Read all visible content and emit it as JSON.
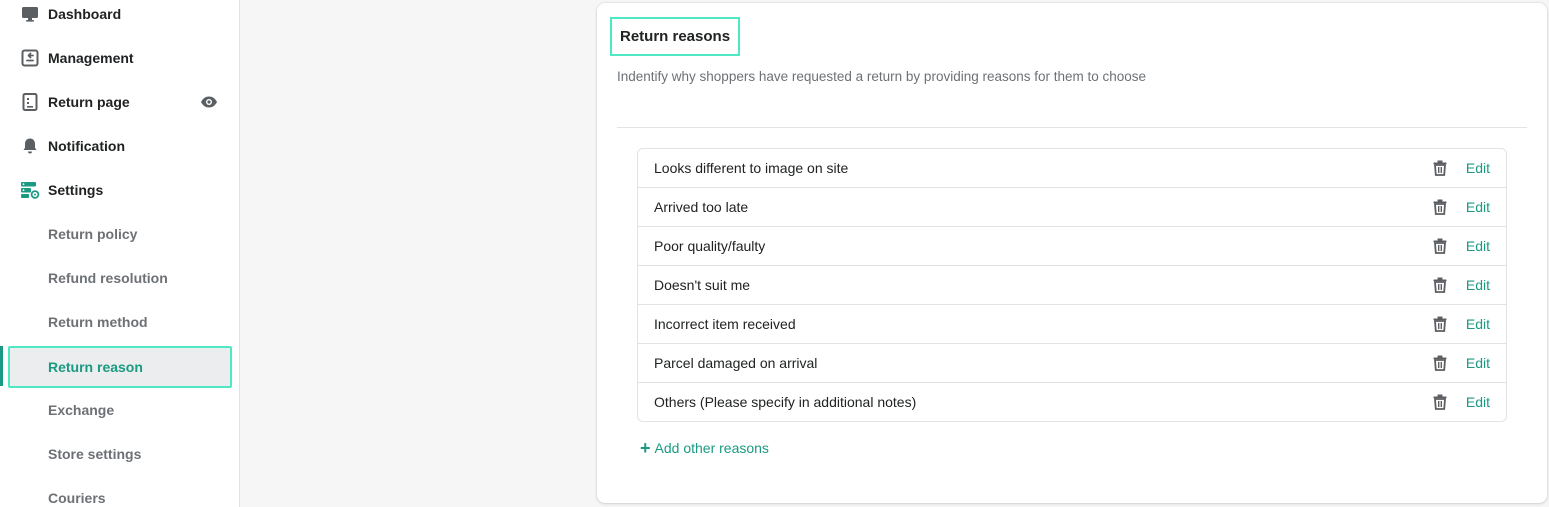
{
  "sidebar": {
    "items": [
      {
        "label": "Dashboard",
        "icon": "monitor-icon"
      },
      {
        "label": "Management",
        "icon": "return-box-icon"
      },
      {
        "label": "Return page",
        "icon": "page-icon"
      },
      {
        "label": "Notification",
        "icon": "bell-icon"
      },
      {
        "label": "Settings",
        "icon": "settings-icon"
      }
    ],
    "sub_items": [
      {
        "label": "Return policy"
      },
      {
        "label": "Refund resolution"
      },
      {
        "label": "Return method"
      },
      {
        "label": "Return reason",
        "active": true
      },
      {
        "label": "Exchange"
      },
      {
        "label": "Store settings"
      },
      {
        "label": "Couriers"
      }
    ]
  },
  "card": {
    "title": "Return reasons",
    "description": "Indentify why shoppers have requested a return by providing reasons for them to choose",
    "edit_label": "Edit",
    "reasons": [
      "Looks different to image on site",
      "Arrived too late",
      "Poor quality/faulty",
      "Doesn't suit me",
      "Incorrect item received",
      "Parcel damaged on arrival",
      "Others (Please specify in additional notes)"
    ],
    "add_label": "Add other reasons"
  },
  "colors": {
    "accent": "#1a9a82",
    "highlight": "#4ee8c4"
  }
}
